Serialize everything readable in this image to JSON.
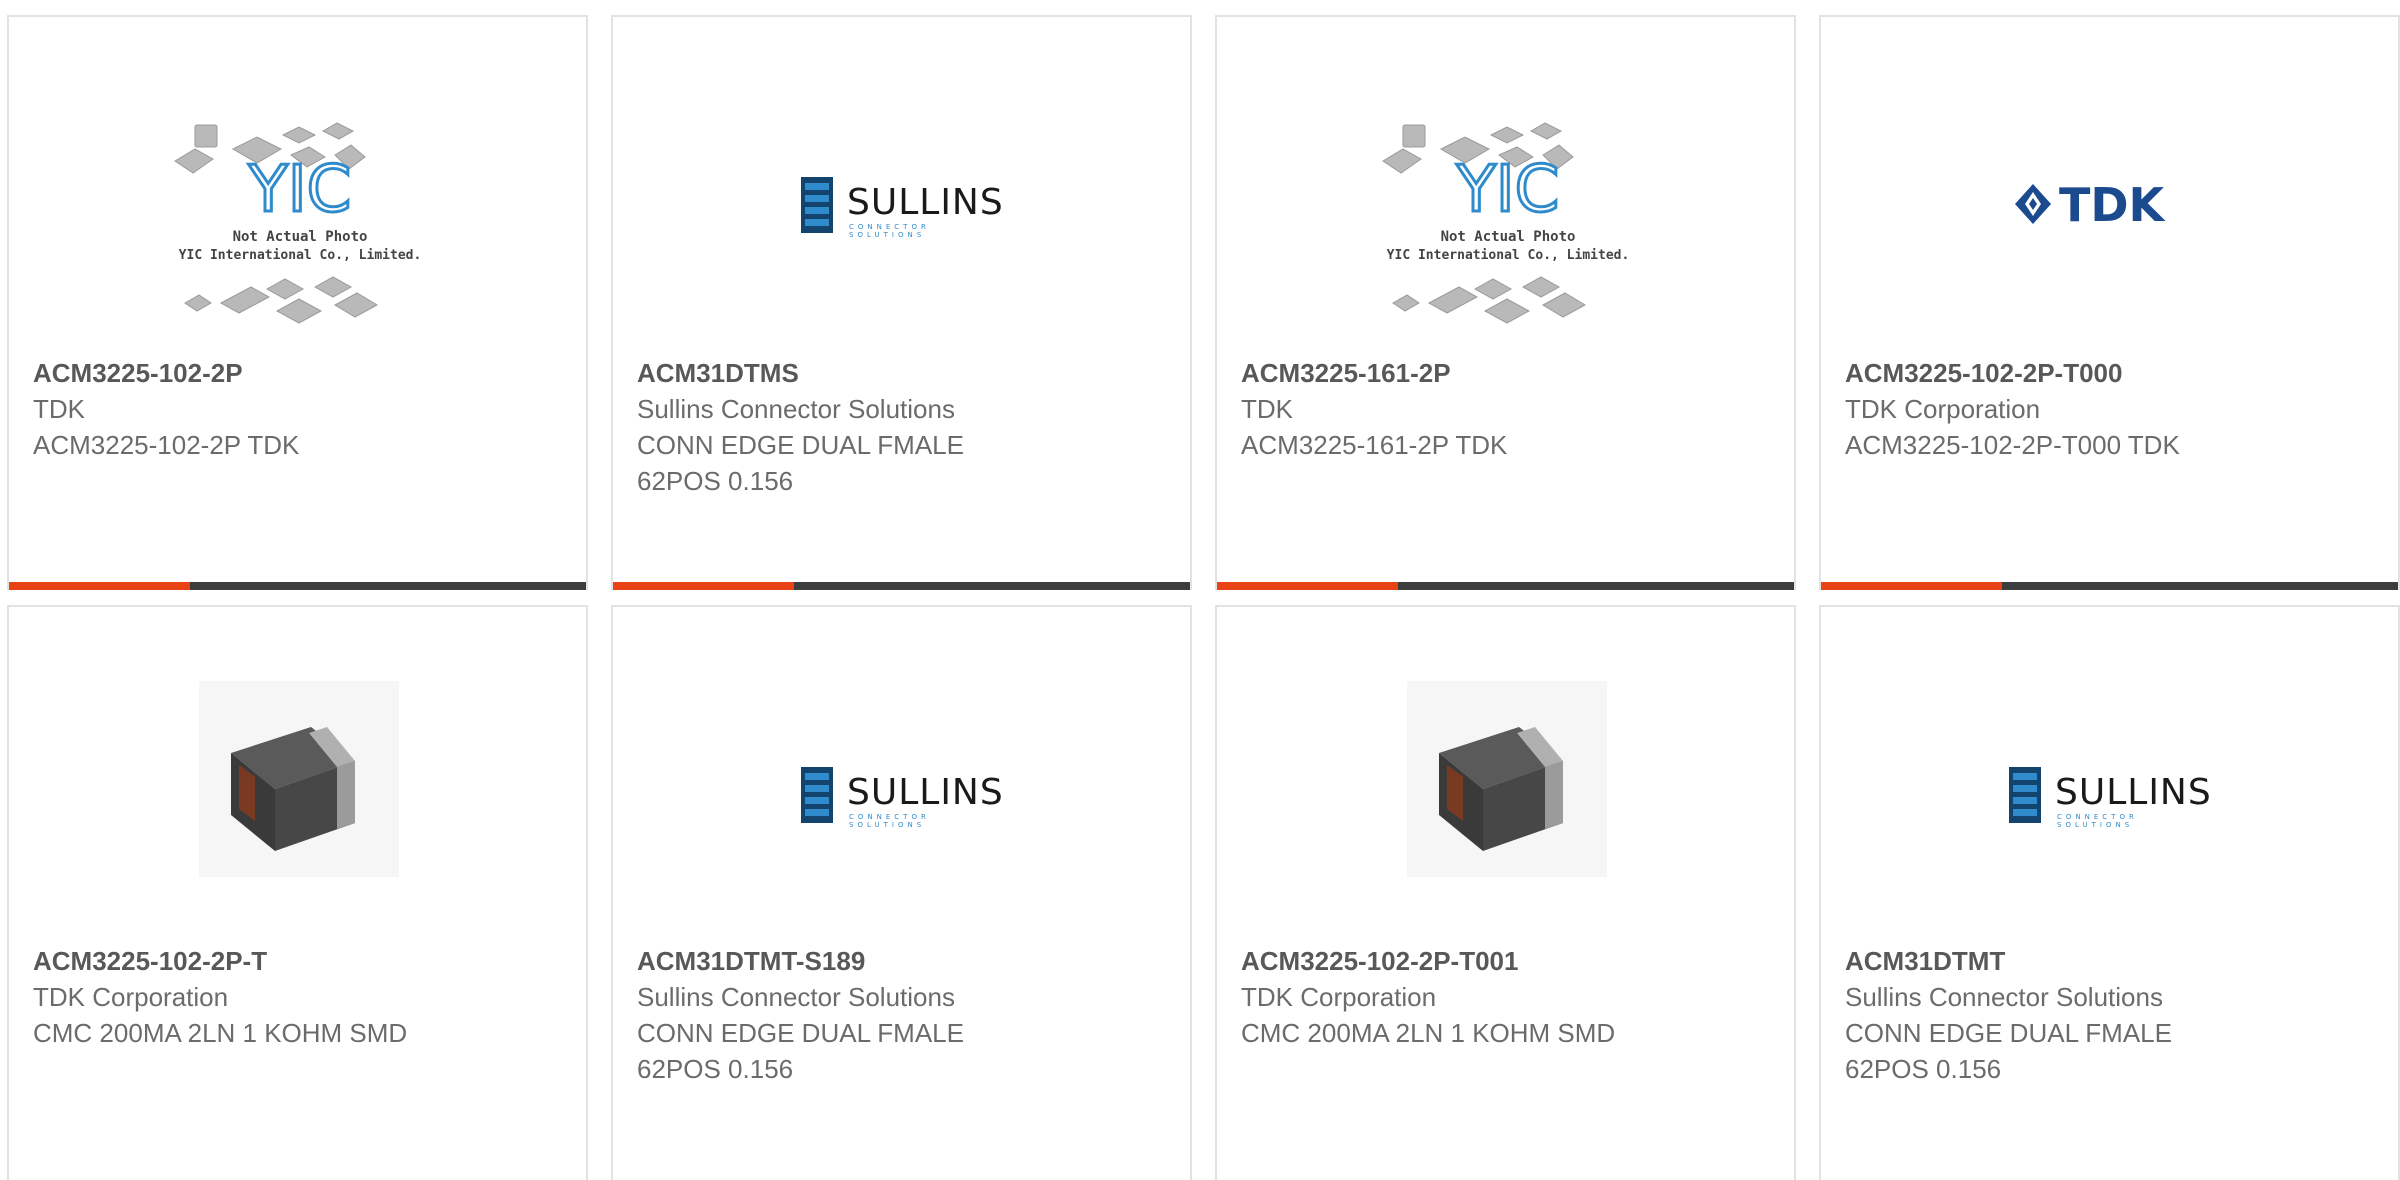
{
  "products": [
    {
      "part": "ACM3225-102-2P",
      "manufacturer": "TDK",
      "description_lines": [
        "ACM3225-102-2P TDK"
      ],
      "image": "yic-placeholder",
      "image_caption": [
        "Not Actual Photo",
        "YIC International Co., Limited."
      ]
    },
    {
      "part": "ACM31DTMS",
      "manufacturer": "Sullins Connector Solutions",
      "description_lines": [
        "CONN EDGE DUAL FMALE",
        "62POS 0.156"
      ],
      "image": "sullins-logo",
      "logo_word": "SULLINS",
      "logo_sub": "CONNECTOR SOLUTIONS"
    },
    {
      "part": "ACM3225-161-2P",
      "manufacturer": "TDK",
      "description_lines": [
        "ACM3225-161-2P TDK"
      ],
      "image": "yic-placeholder",
      "image_caption": [
        "Not Actual Photo",
        "YIC International Co., Limited."
      ]
    },
    {
      "part": "ACM3225-102-2P-T000",
      "manufacturer": "TDK Corporation",
      "description_lines": [
        "ACM3225-102-2P-T000 TDK"
      ],
      "image": "tdk-logo",
      "logo_word": "TDK"
    },
    {
      "part": "ACM3225-102-2P-T",
      "manufacturer": "TDK Corporation",
      "description_lines": [
        "CMC 200MA 2LN 1 KOHM SMD"
      ],
      "image": "inductor-photo"
    },
    {
      "part": "ACM31DTMT-S189",
      "manufacturer": "Sullins Connector Solutions",
      "description_lines": [
        "CONN EDGE DUAL FMALE",
        "62POS 0.156"
      ],
      "image": "sullins-logo",
      "logo_word": "SULLINS",
      "logo_sub": "CONNECTOR SOLUTIONS"
    },
    {
      "part": "ACM3225-102-2P-T001",
      "manufacturer": "TDK Corporation",
      "description_lines": [
        "CMC 200MA 2LN 1 KOHM SMD"
      ],
      "image": "inductor-photo"
    },
    {
      "part": "ACM31DTMT",
      "manufacturer": "Sullins Connector Solutions",
      "description_lines": [
        "CONN EDGE DUAL FMALE",
        "62POS 0.156"
      ],
      "image": "sullins-logo",
      "logo_word": "SULLINS",
      "logo_sub": "CONNECTOR SOLUTIONS"
    }
  ],
  "colors": {
    "accent": "#e94214",
    "bar": "#3d3d3d",
    "text": "#6b6b6b",
    "border": "#e2e2e2"
  }
}
